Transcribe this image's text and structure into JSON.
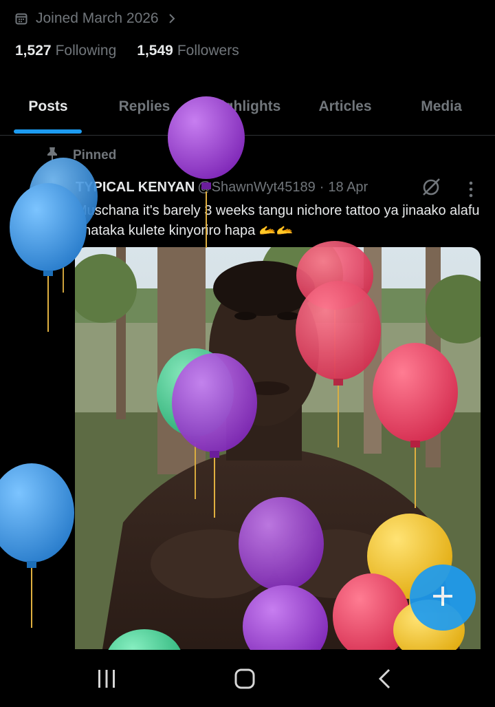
{
  "profile": {
    "joined_text": "Joined March 2026",
    "following_count": "1,527",
    "following_label": "Following",
    "followers_count": "1,549",
    "followers_label": "Followers"
  },
  "tabs": [
    {
      "label": "Posts",
      "active": true
    },
    {
      "label": "Replies",
      "active": false
    },
    {
      "label": "Highlights",
      "active": false
    },
    {
      "label": "Articles",
      "active": false
    },
    {
      "label": "Media",
      "active": false
    }
  ],
  "post": {
    "pinned_label": "Pinned",
    "author_name": "TYPICAL KENYAN",
    "author_handle": "@ShawnWyt45189",
    "separator": "·",
    "date": "18 Apr",
    "text": "Muschana it's barely 3 weeks tangu nichore tattoo ya jinaako alafu unataka kulete kinyoriro hapa 🫴🫴",
    "media_description_icon": "photo"
  },
  "fab": {
    "icon": "plus-icon",
    "color": "#1d9bf0"
  },
  "system_nav": {
    "icons": [
      "recents-icon",
      "home-icon",
      "back-icon"
    ]
  },
  "colors": {
    "accent": "#1d9bf0",
    "balloon_blue": "#3b97e3",
    "balloon_purple": "#9b3fd6",
    "balloon_red": "#ee3f63",
    "balloon_green": "#3fcf93",
    "balloon_yellow": "#f2c21c"
  }
}
